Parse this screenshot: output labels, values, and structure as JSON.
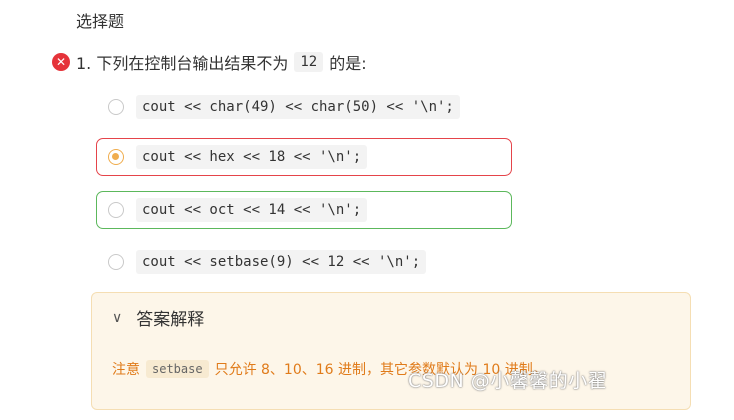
{
  "section": {
    "title": "选择题"
  },
  "question": {
    "prefix": "1. 下列在控制台输出结果不为",
    "code": "12",
    "suffix": "的是:"
  },
  "options": [
    {
      "code": "cout << char(49) << char(50) << '\\n';",
      "state": "normal"
    },
    {
      "code": "cout << hex << 18 << '\\n';",
      "state": "wrong-selected"
    },
    {
      "code": "cout << oct << 14 << '\\n';",
      "state": "correct"
    },
    {
      "code": "cout << setbase(9) << 12 << '\\n';",
      "state": "normal"
    }
  ],
  "answer": {
    "header": "答案解释",
    "note_prefix": "注意",
    "note_code": "setbase",
    "note_suffix": "只允许 8、10、16 进制，其它参数默认为 10 进制。"
  },
  "watermark": "CSDN @小馨馨的小翟",
  "colors": {
    "wrong": "#e5444a",
    "correct": "#5cb85c",
    "selected": "#f0ad4e",
    "answer_bg": "#fdf6e9",
    "answer_text": "#e07b1a"
  },
  "icons": {
    "wrong": "close-circle-icon",
    "chevron": "chevron-down-icon"
  }
}
